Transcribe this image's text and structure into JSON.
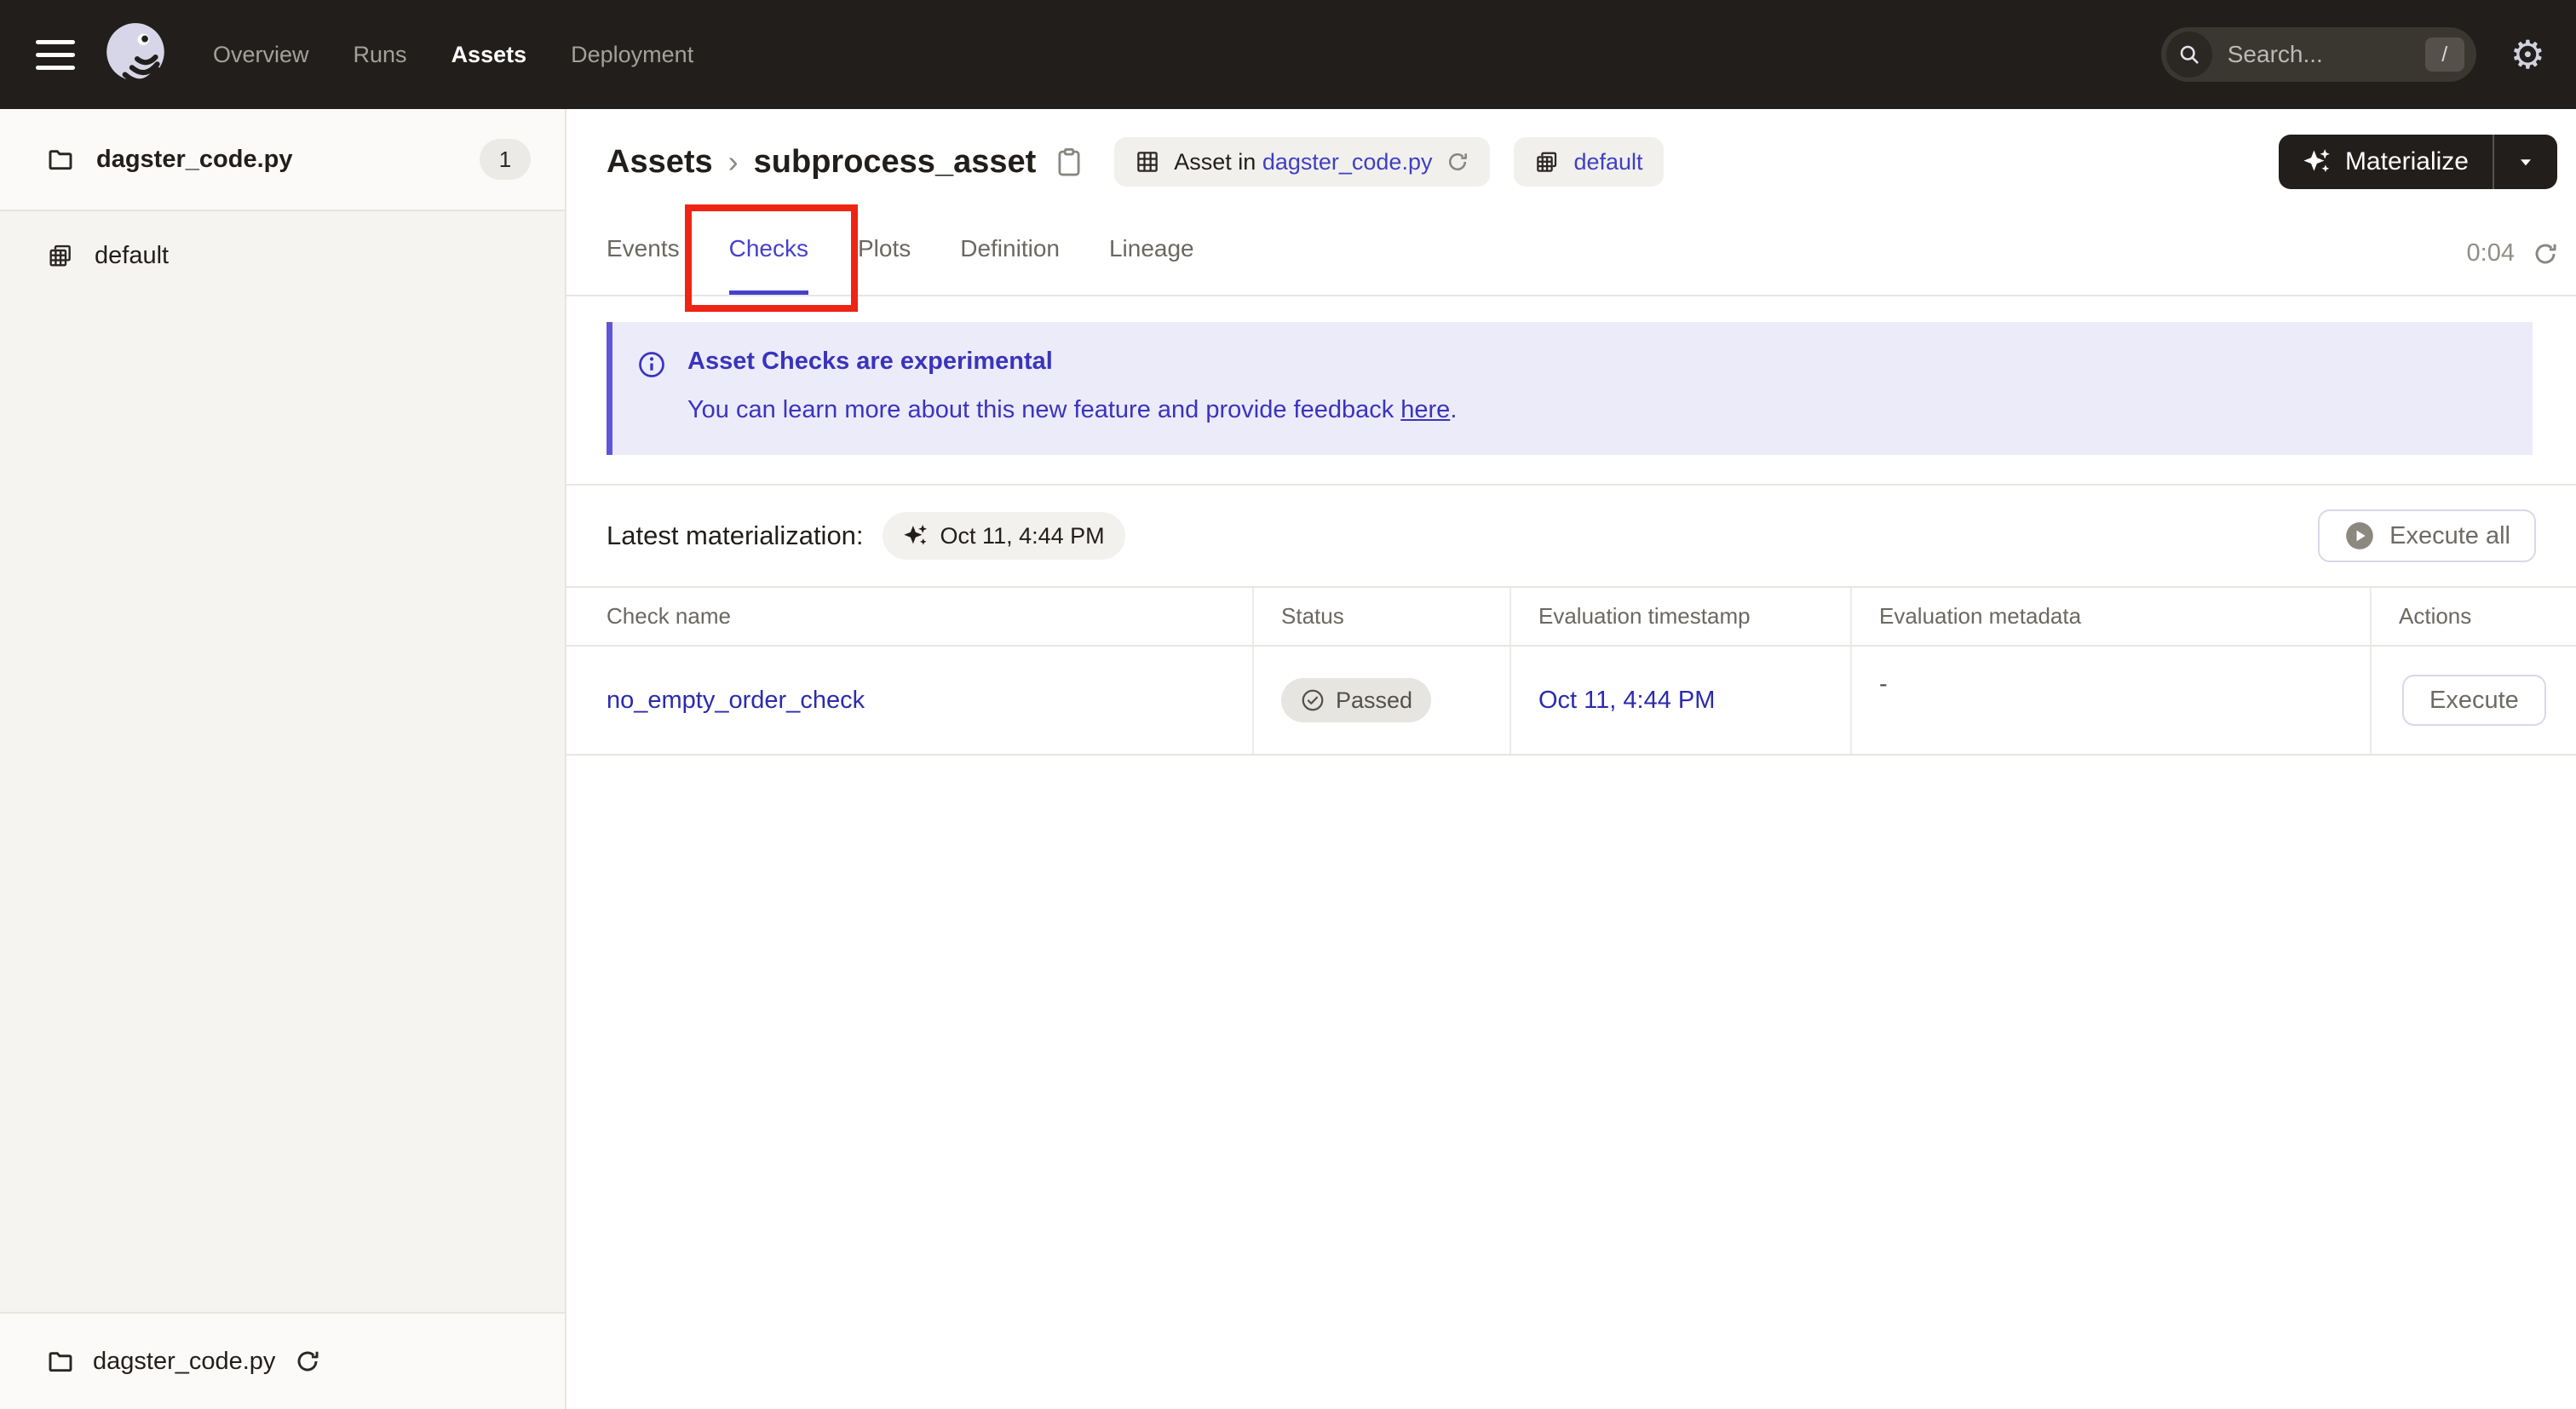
{
  "nav": {
    "links": [
      {
        "label": "Overview",
        "active": false
      },
      {
        "label": "Runs",
        "active": false
      },
      {
        "label": "Assets",
        "active": true
      },
      {
        "label": "Deployment",
        "active": false
      }
    ],
    "search": {
      "placeholder": "Search...",
      "shortcut": "/"
    }
  },
  "sidebar": {
    "top_item": {
      "label": "dagster_code.py",
      "count": "1"
    },
    "item_default": {
      "label": "default"
    },
    "bottom_item": {
      "label": "dagster_code.py"
    }
  },
  "header": {
    "breadcrumb": {
      "root": "Assets",
      "separator": "›",
      "current": "subprocess_asset"
    },
    "asset_badge": {
      "prefix": "Asset in ",
      "link": "dagster_code.py"
    },
    "repo_badge": {
      "label": "default"
    },
    "materialize": {
      "label": "Materialize"
    }
  },
  "tabs": {
    "items": [
      {
        "label": "Events"
      },
      {
        "label": "Checks"
      },
      {
        "label": "Plots"
      },
      {
        "label": "Definition"
      },
      {
        "label": "Lineage"
      }
    ],
    "active": "Checks",
    "timer": "0:04"
  },
  "banner": {
    "title": "Asset Checks are experimental",
    "body": "You can learn more about this new feature and provide feedback ",
    "link": "here",
    "suffix": "."
  },
  "toolbar": {
    "label": "Latest materialization:",
    "timestamp": "Oct 11, 4:44 PM",
    "execute_all": "Execute all"
  },
  "table": {
    "columns": [
      "Check name",
      "Status",
      "Evaluation timestamp",
      "Evaluation metadata",
      "Actions"
    ],
    "rows": [
      {
        "name": "no_empty_order_check",
        "status": "Passed",
        "timestamp": "Oct 11, 4:44 PM",
        "metadata": "-",
        "action": "Execute"
      }
    ]
  },
  "colors": {
    "nav_bg": "#221E1B",
    "accent_indigo": "#4540CE",
    "banner_bg": "#ECEBFA",
    "banner_border": "#5F55D9",
    "banner_text": "#3A34BC",
    "link_blue": "#3F3FC4",
    "table_link": "#2B2BAD",
    "annotation_red": "#EE2414"
  }
}
